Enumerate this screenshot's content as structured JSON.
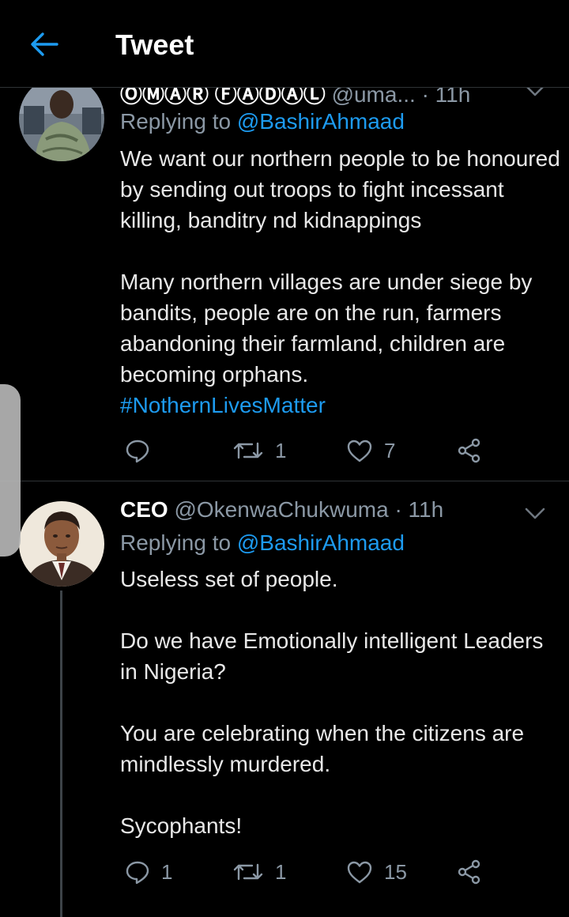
{
  "header": {
    "title": "Tweet",
    "back_icon": "arrow-left-icon"
  },
  "colors": {
    "accent": "#1d9bf0",
    "background": "#000000",
    "muted": "#8b98a5",
    "divider": "#2f3336"
  },
  "tweets": [
    {
      "display_name": "ⓄⓂⒶⓇ ⒻⒶⒹⒶⓁ",
      "handle": "@uma...",
      "time": "· 11h",
      "replying_label": "Replying to",
      "replying_to": "@BashirAhmaad",
      "paragraphs": [
        "We want our northern people to be honoured by sending out troops to fight incessant killing, banditry nd kidnappings",
        "Many northern villages are under siege by bandits, people are on the run, farmers abandoning their farmland, children are becoming orphans."
      ],
      "hashtag": "#NothernLivesMatter",
      "replies": "",
      "retweets": "1",
      "likes": "7"
    },
    {
      "display_name": "CEO",
      "handle": "@OkenwaChukwuma",
      "time": "· 11h",
      "replying_label": "Replying to",
      "replying_to": "@BashirAhmaad",
      "paragraphs": [
        "Useless set of people.",
        "Do we have Emotionally intelligent Leaders in Nigeria?",
        "You are celebrating when the citizens are mindlessly murdered.",
        "Sycophants!"
      ],
      "replies": "1",
      "retweets": "1",
      "likes": "15"
    }
  ]
}
